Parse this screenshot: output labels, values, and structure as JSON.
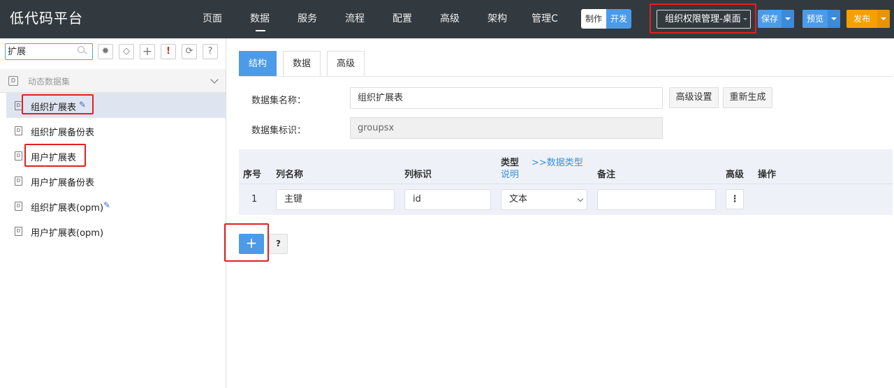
{
  "header": {
    "logo": "低代码平台",
    "nav": [
      "页面",
      "数据",
      "服务",
      "流程",
      "配置",
      "高级",
      "架构",
      "管理C"
    ],
    "mode": {
      "make": "制作",
      "dev": "开发"
    },
    "app_select": "组织权限管理-桌面",
    "save": "保存",
    "preview": "预览",
    "publish": "发布"
  },
  "sidebar": {
    "search_value": "扩展",
    "tools": [
      "bug-icon",
      "tag-icon",
      "plus-icon",
      "alert-icon",
      "refresh-icon",
      "help-icon"
    ],
    "tool_glyphs": [
      "✹",
      "◇",
      "+",
      "!",
      "⟳",
      "?"
    ],
    "group_label": "动态数据集",
    "items": [
      {
        "label": "组织扩展表",
        "editable": true,
        "selected": true
      },
      {
        "label": "组织扩展备份表",
        "editable": false
      },
      {
        "label": "用户扩展表",
        "editable": false
      },
      {
        "label": "用户扩展备份表",
        "editable": false
      },
      {
        "label": "组织扩展表(opm)",
        "editable": true
      },
      {
        "label": "用户扩展表(opm)",
        "editable": false
      }
    ]
  },
  "main": {
    "tabs": [
      "结构",
      "数据",
      "高级"
    ],
    "active_tab": 0,
    "form": {
      "name_label": "数据集名称：",
      "name_value": "组织扩展表",
      "id_label": "数据集标识：",
      "id_value": "groupsx",
      "advanced_settings": "高级设置",
      "regenerate": "重新生成"
    },
    "table": {
      "headers": {
        "seq": "序号",
        "col_name": "列名称",
        "col_id": "列标识",
        "type": "类型",
        "type_desc": "说明",
        "data_type_link": ">>数据类型",
        "remark": "备注",
        "advanced": "高级",
        "ops": "操作"
      },
      "rows": [
        {
          "seq": "1",
          "col_name": "主键",
          "col_id": "id",
          "type": "文本",
          "remark": "",
          "more": "⋮"
        }
      ]
    },
    "add_glyph": "+",
    "help_glyph": "?"
  },
  "colors": {
    "topbar": "#333a3f",
    "accent": "#4b9be8",
    "publish": "#f5a000",
    "highlight": "#e02020"
  }
}
